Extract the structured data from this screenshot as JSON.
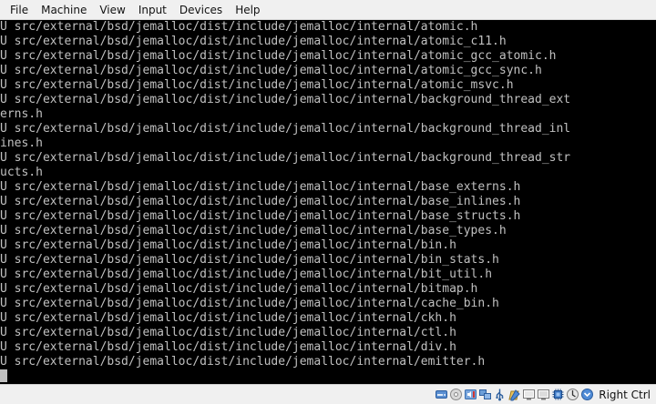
{
  "menubar": {
    "items": [
      "File",
      "Machine",
      "View",
      "Input",
      "Devices",
      "Help"
    ]
  },
  "console": {
    "lines": [
      "U src/external/bsd/jemalloc/dist/include/jemalloc/internal/atomic.h",
      "U src/external/bsd/jemalloc/dist/include/jemalloc/internal/atomic_c11.h",
      "U src/external/bsd/jemalloc/dist/include/jemalloc/internal/atomic_gcc_atomic.h",
      "U src/external/bsd/jemalloc/dist/include/jemalloc/internal/atomic_gcc_sync.h",
      "U src/external/bsd/jemalloc/dist/include/jemalloc/internal/atomic_msvc.h",
      "U src/external/bsd/jemalloc/dist/include/jemalloc/internal/background_thread_ext",
      "erns.h",
      "U src/external/bsd/jemalloc/dist/include/jemalloc/internal/background_thread_inl",
      "ines.h",
      "U src/external/bsd/jemalloc/dist/include/jemalloc/internal/background_thread_str",
      "ucts.h",
      "U src/external/bsd/jemalloc/dist/include/jemalloc/internal/base_externs.h",
      "U src/external/bsd/jemalloc/dist/include/jemalloc/internal/base_inlines.h",
      "U src/external/bsd/jemalloc/dist/include/jemalloc/internal/base_structs.h",
      "U src/external/bsd/jemalloc/dist/include/jemalloc/internal/base_types.h",
      "U src/external/bsd/jemalloc/dist/include/jemalloc/internal/bin.h",
      "U src/external/bsd/jemalloc/dist/include/jemalloc/internal/bin_stats.h",
      "U src/external/bsd/jemalloc/dist/include/jemalloc/internal/bit_util.h",
      "U src/external/bsd/jemalloc/dist/include/jemalloc/internal/bitmap.h",
      "U src/external/bsd/jemalloc/dist/include/jemalloc/internal/cache_bin.h",
      "U src/external/bsd/jemalloc/dist/include/jemalloc/internal/ckh.h",
      "U src/external/bsd/jemalloc/dist/include/jemalloc/internal/ctl.h",
      "U src/external/bsd/jemalloc/dist/include/jemalloc/internal/div.h",
      "U src/external/bsd/jemalloc/dist/include/jemalloc/internal/emitter.h"
    ]
  },
  "statusbar": {
    "icons": [
      "hard-disk-icon",
      "optical-drive-icon",
      "audio-icon",
      "network-icon",
      "usb-icon",
      "shared-folders-icon",
      "display-icon",
      "video-capture-icon",
      "cpu-icon",
      "mouse-integration-icon",
      "host-key-arrow-icon"
    ],
    "host_key": "Right Ctrl"
  },
  "colors": {
    "console_bg": "#000000",
    "console_text": "#c0c0c0",
    "chrome_bg": "#f0f0f0"
  }
}
